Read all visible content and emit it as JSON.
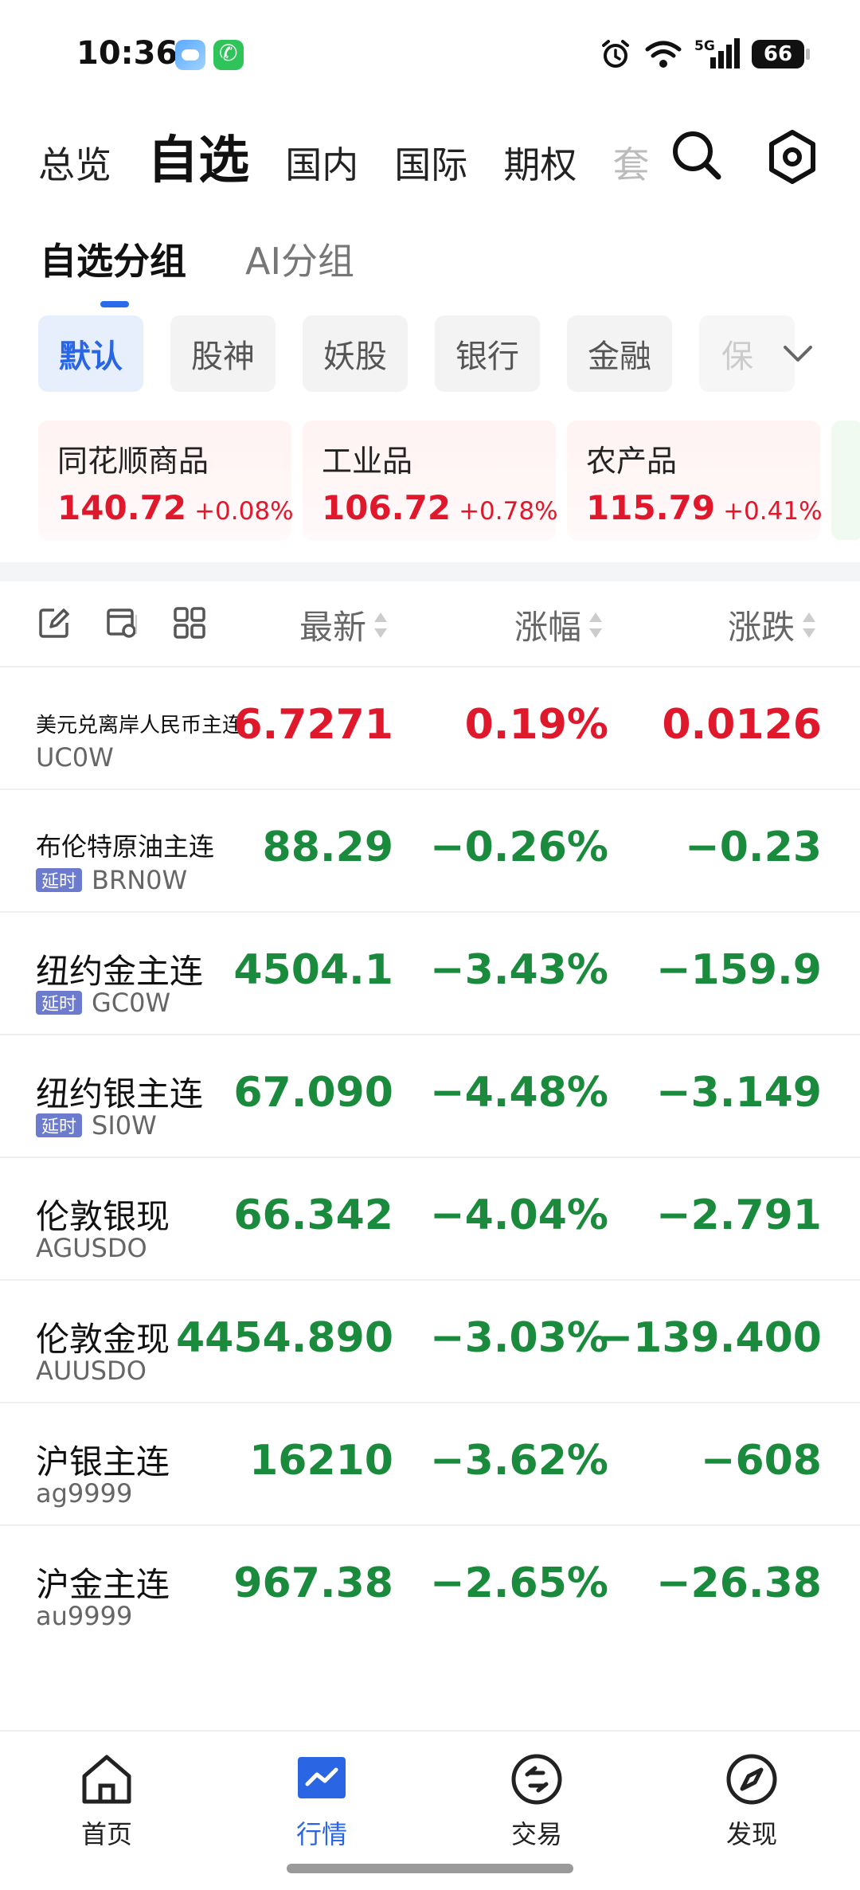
{
  "status_bar": {
    "time": "10:36",
    "network": "5G",
    "battery": "66"
  },
  "top_tabs": [
    {
      "label": "总览",
      "active": false
    },
    {
      "label": "自选",
      "active": true
    },
    {
      "label": "国内",
      "active": false
    },
    {
      "label": "国际",
      "active": false
    },
    {
      "label": "期权",
      "active": false
    },
    {
      "label": "套",
      "active": false
    }
  ],
  "sub_tabs": [
    {
      "label": "自选分组",
      "active": true
    },
    {
      "label": "AI分组",
      "active": false
    }
  ],
  "groups": [
    "默认",
    "股神",
    "妖股",
    "银行",
    "金融",
    "保"
  ],
  "index_cards": [
    {
      "name": "同花顺商品",
      "price": "140.72",
      "pct": "+0.08%"
    },
    {
      "name": "工业品",
      "price": "106.72",
      "pct": "+0.78%"
    },
    {
      "name": "农产品",
      "price": "115.79",
      "pct": "+0.41%"
    }
  ],
  "list_header": {
    "latest": "最新",
    "pct_change": "涨幅",
    "change": "涨跌"
  },
  "rows": [
    {
      "name": "美元兑离岸人民币主连",
      "code": "UC0W",
      "delay": "",
      "price": "6.7271",
      "pct": "0.19%",
      "change": "0.0126",
      "trend": "up"
    },
    {
      "name": "布伦特原油主连",
      "code": "BRN0W",
      "delay": "延时",
      "price": "88.29",
      "pct": "−0.26%",
      "change": "−0.23",
      "trend": "down"
    },
    {
      "name": "纽约金主连",
      "code": "GC0W",
      "delay": "延时",
      "price": "4504.1",
      "pct": "−3.43%",
      "change": "−159.9",
      "trend": "down"
    },
    {
      "name": "纽约银主连",
      "code": "SI0W",
      "delay": "延时",
      "price": "67.090",
      "pct": "−4.48%",
      "change": "−3.149",
      "trend": "down"
    },
    {
      "name": "伦敦银现",
      "code": "AGUSDO",
      "delay": "",
      "price": "66.342",
      "pct": "−4.04%",
      "change": "−2.791",
      "trend": "down"
    },
    {
      "name": "伦敦金现",
      "code": "AUUSDO",
      "delay": "",
      "price": "4454.890",
      "pct": "−3.03%",
      "change": "−139.400",
      "trend": "down"
    },
    {
      "name": "沪银主连",
      "code": "ag9999",
      "delay": "",
      "price": "16210",
      "pct": "−3.62%",
      "change": "−608",
      "trend": "down"
    },
    {
      "name": "沪金主连",
      "code": "au9999",
      "delay": "",
      "price": "967.38",
      "pct": "−2.65%",
      "change": "−26.38",
      "trend": "down"
    }
  ],
  "bottom_nav": [
    {
      "label": "首页",
      "icon": "home-icon",
      "active": false
    },
    {
      "label": "行情",
      "icon": "chart-icon",
      "active": true
    },
    {
      "label": "交易",
      "icon": "trade-icon",
      "active": false
    },
    {
      "label": "发现",
      "icon": "compass-icon",
      "active": false
    }
  ],
  "colors": {
    "up": "#e0182c",
    "down": "#1a8a3c",
    "accent": "#2a66e3",
    "delay_badge": "#6d7bce"
  }
}
